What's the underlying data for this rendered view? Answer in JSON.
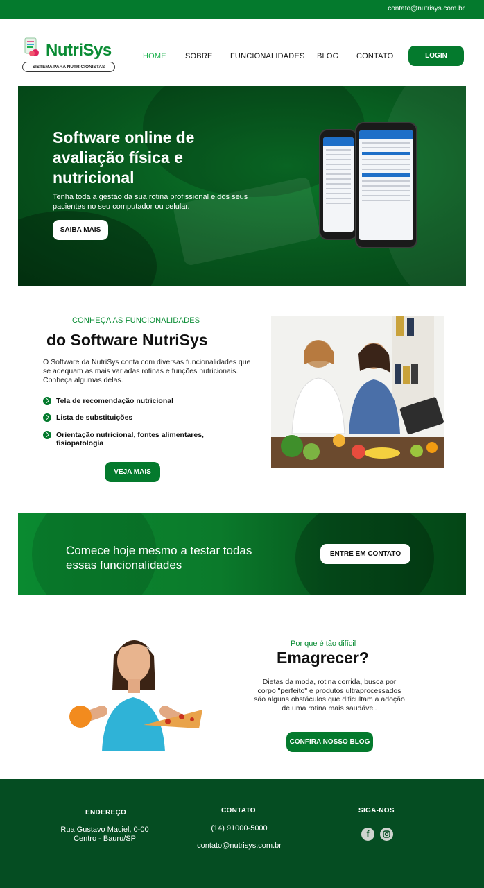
{
  "topbar": {
    "email": "contato@nutrisys.com.br"
  },
  "logo": {
    "name": "NutriSys",
    "tagline": "SISTEMA PARA NUTRICIONISTAS"
  },
  "nav": {
    "items": [
      "HOME",
      "SOBRE",
      "FUNCIONALIDADES",
      "BLOG",
      "CONTATO"
    ],
    "active": "HOME",
    "login": "LOGIN"
  },
  "hero": {
    "title": "Software online de avaliação física e nutricional",
    "subtitle": "Tenha toda a gestão da sua rotina profissional e dos seus pacientes no seu computador ou celular.",
    "button": "SAIBA MAIS"
  },
  "features": {
    "kicker": "CONHEÇA AS FUNCIONALIDADES",
    "title": "do Software NutriSys",
    "description": "O Software da NutriSys conta com diversas funcionalidades que se adequam as mais variadas rotinas e funções nutricionais. Conheça algumas delas.",
    "items": [
      "Tela de recomendação nutricional",
      "Lista de substituições",
      "Orientação nutricional, fontes alimentares, fisiopatologia"
    ],
    "button": "VEJA MAIS"
  },
  "cta": {
    "text": "Comece hoje mesmo a testar todas essas funcionalidades",
    "button": "ENTRE EM CONTATO"
  },
  "why": {
    "kicker": "Por que é tão difícil",
    "title": "Emagrecer?",
    "description": "Dietas da moda, rotina corrida, busca por corpo \"perfeito\" e produtos ultraprocessados são alguns obstáculos que dificultam a adoção de uma rotina mais saudável.",
    "button": "CONFIRA NOSSO BLOG"
  },
  "footer": {
    "address": {
      "heading": "ENDEREÇO",
      "line1": "Rua Gustavo Maciel, 0-00",
      "line2": "Centro - Bauru/SP"
    },
    "contact": {
      "heading": "CONTATO",
      "phone": "(14) 91000-5000",
      "email": "contato@nutrisys.com.br"
    },
    "social": {
      "heading": "SIGA-NOS",
      "icons": [
        "facebook-icon",
        "instagram-icon"
      ]
    }
  },
  "colors": {
    "primary": "#047a2d",
    "accent": "#19b04b",
    "footer": "#054d22"
  }
}
